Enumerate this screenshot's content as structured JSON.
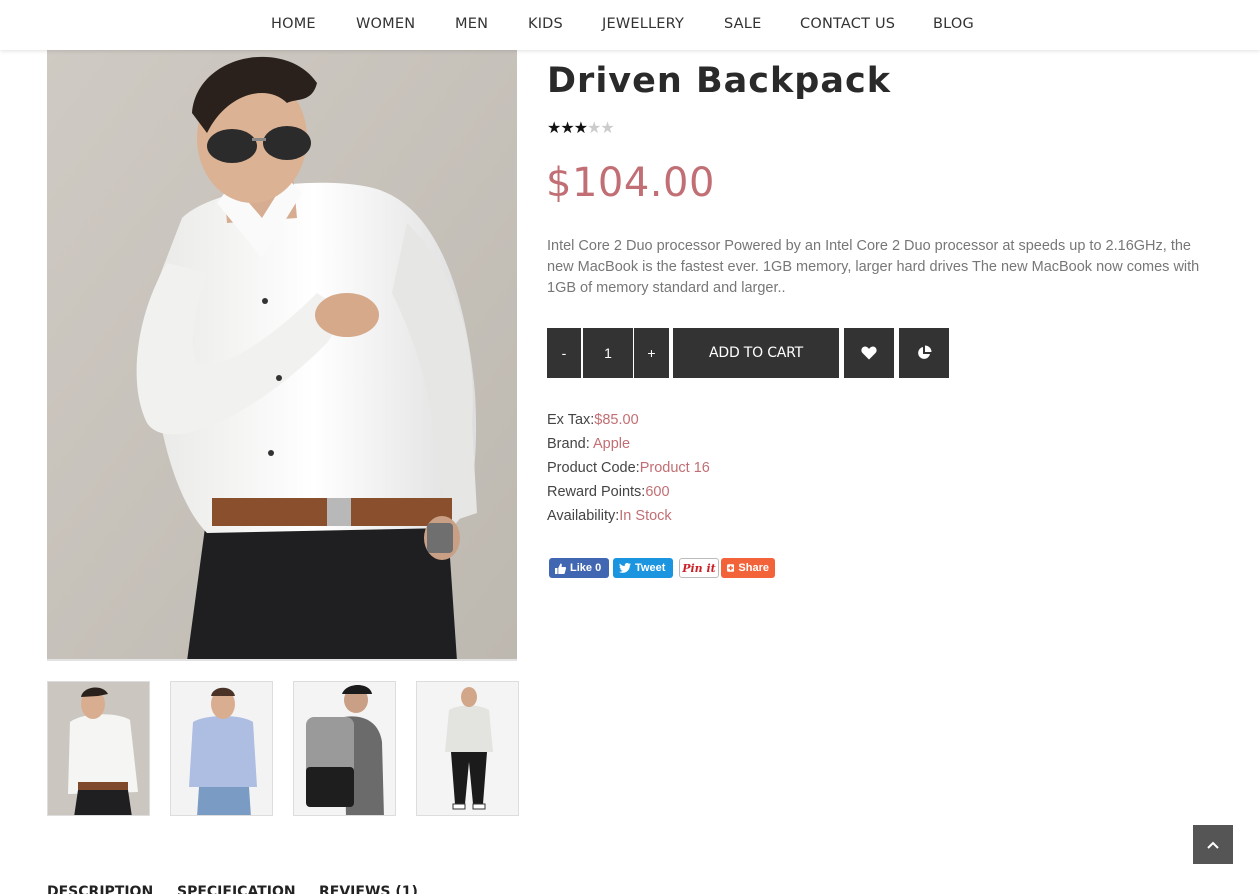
{
  "nav": {
    "items": [
      "HOME",
      "WOMEN",
      "MEN",
      "KIDS",
      "JEWELLERY",
      "SALE",
      "CONTACT US",
      "BLOG"
    ]
  },
  "product": {
    "title": "Driven Backpack",
    "rating": 3,
    "rating_max": 5,
    "price": "$104.00",
    "description": "Intel Core 2 Duo processor Powered by an Intel Core 2 Duo processor at speeds up to 2.16GHz, the new MacBook is the fastest ever. 1GB memory, larger hard drives The new MacBook now comes with 1GB of memory standard and larger..",
    "quantity": "1",
    "qty_minus_label": "-",
    "qty_plus_label": "+",
    "add_to_cart_label": "ADD TO CART",
    "specs": [
      {
        "label": "Ex Tax:",
        "value": "$85.00"
      },
      {
        "label": "Brand: ",
        "value": "Apple"
      },
      {
        "label": "Product Code:",
        "value": "Product 16"
      },
      {
        "label": "Reward Points:",
        "value": "600"
      },
      {
        "label": "Availability:",
        "value": "In Stock"
      }
    ]
  },
  "social": {
    "like_label": "Like 0",
    "tweet_label": "Tweet",
    "pin_label": "Pin it",
    "share_label": "Share"
  },
  "tabs": [
    "DESCRIPTION",
    "SPECIFICATION",
    "REVIEWS (1)"
  ],
  "icons": {
    "wishlist": "heart-icon",
    "compare": "pie-chart-icon",
    "scroll_top": "chevron-up-icon"
  },
  "colors": {
    "accent": "#c16f74",
    "button_dark": "#333333"
  }
}
